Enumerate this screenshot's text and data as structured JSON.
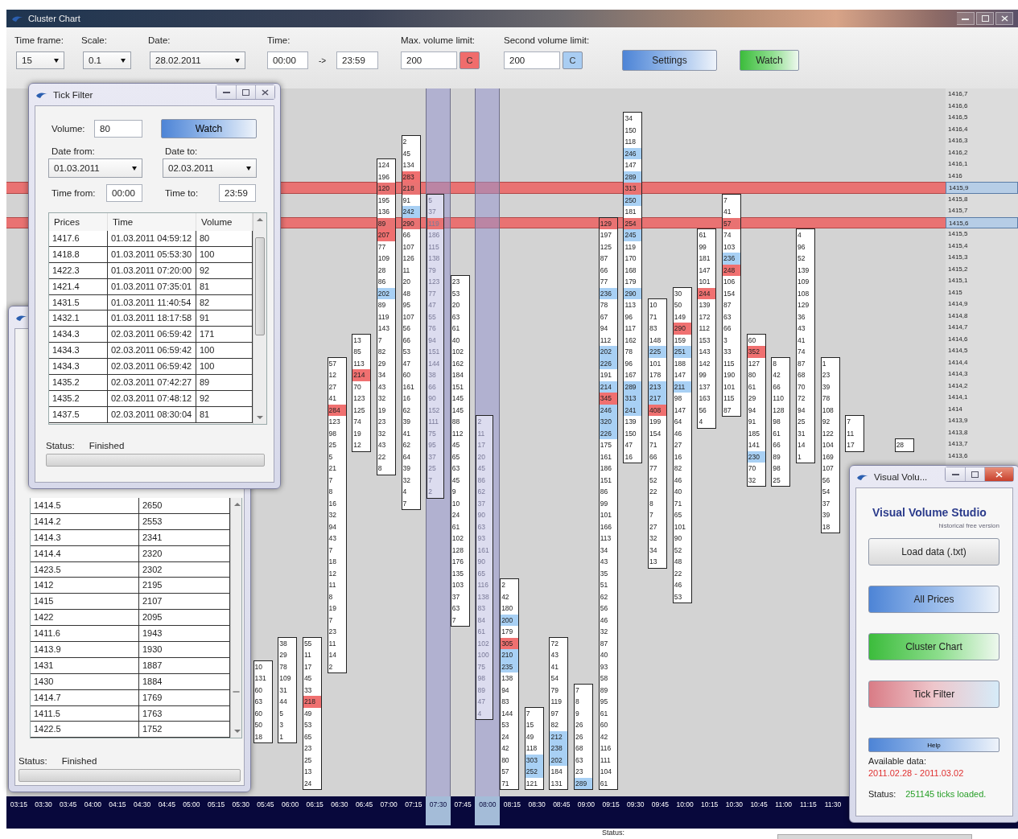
{
  "window": {
    "title": "Cluster Chart"
  },
  "toolbar": {
    "time_frame": {
      "label": "Time frame:",
      "value": "15"
    },
    "scale": {
      "label": "Scale:",
      "value": "0.1"
    },
    "date": {
      "label": "Date:",
      "value": "28.02.2011"
    },
    "time": {
      "label": "Time:",
      "from": "00:00",
      "separator": "->",
      "to": "23:59"
    },
    "max_volume": {
      "label": "Max. volume limit:",
      "value": "200",
      "button": "C",
      "color": "#f06c6c"
    },
    "second_volume": {
      "label": "Second volume limit:",
      "value": "200",
      "button": "C",
      "color": "#a9cdf2"
    },
    "buttons": [
      {
        "label": "Settings",
        "kind": "blue"
      },
      {
        "label": "Watch",
        "kind": "green"
      }
    ]
  },
  "chart": {
    "price_axis": [
      {
        "label": "1416,7",
        "selected": false
      },
      {
        "label": "1416,6",
        "selected": false
      },
      {
        "label": "1416,5",
        "selected": false
      },
      {
        "label": "1416,4",
        "selected": false
      },
      {
        "label": "1416,3",
        "selected": false
      },
      {
        "label": "1416,2",
        "selected": false
      },
      {
        "label": "1416,1",
        "selected": false
      },
      {
        "label": "1416",
        "selected": false
      },
      {
        "label": "1415,9",
        "selected": true
      },
      {
        "label": "1415,8",
        "selected": false
      },
      {
        "label": "1415,7",
        "selected": false
      },
      {
        "label": "1415,6",
        "selected": true
      },
      {
        "label": "1415,5",
        "selected": false
      },
      {
        "label": "1415,4",
        "selected": false
      },
      {
        "label": "1415,3",
        "selected": false
      },
      {
        "label": "1415,2",
        "selected": false
      },
      {
        "label": "1415,1",
        "selected": false
      },
      {
        "label": "1415",
        "selected": false
      },
      {
        "label": "1414,9",
        "selected": false
      },
      {
        "label": "1414,8",
        "selected": false
      },
      {
        "label": "1414,7",
        "selected": false
      },
      {
        "label": "1414,6",
        "selected": false
      },
      {
        "label": "1414,5",
        "selected": false
      },
      {
        "label": "1414,4",
        "selected": false
      },
      {
        "label": "1414,3",
        "selected": false
      },
      {
        "label": "1414,2",
        "selected": false
      },
      {
        "label": "1414,1",
        "selected": false
      },
      {
        "label": "1414",
        "selected": false
      },
      {
        "label": "1413,9",
        "selected": false
      },
      {
        "label": "1413,8",
        "selected": false
      },
      {
        "label": "1413,7",
        "selected": false
      },
      {
        "label": "1413,6",
        "selected": false
      }
    ],
    "slots": [
      {
        "time": "03:15",
        "selected": false
      },
      {
        "time": "03:30",
        "selected": false
      },
      {
        "time": "03:45",
        "selected": false
      },
      {
        "time": "04:00",
        "selected": false
      },
      {
        "time": "04:15",
        "selected": false
      },
      {
        "time": "04:30",
        "selected": false
      },
      {
        "time": "04:45",
        "selected": false
      },
      {
        "time": "05:00",
        "selected": false
      },
      {
        "time": "05:15",
        "selected": false
      },
      {
        "time": "05:30",
        "selected": false
      },
      {
        "time": "05:45",
        "selected": false,
        "cells": [
          null,
          null,
          null,
          null,
          null,
          null,
          null,
          null,
          null,
          null,
          null,
          null,
          null,
          null,
          null,
          null,
          null,
          null,
          null,
          null,
          null,
          null,
          null,
          null,
          null,
          null,
          null,
          null,
          null,
          null,
          null,
          null,
          null,
          null,
          null,
          null,
          null,
          null,
          null,
          null,
          null,
          null,
          null,
          null,
          null,
          null,
          null,
          null,
          null,
          "10",
          "131",
          "60",
          "63",
          "60",
          "50",
          "18"
        ]
      },
      {
        "time": "06:00",
        "selected": false,
        "cells": [
          null,
          null,
          null,
          null,
          null,
          null,
          null,
          null,
          null,
          null,
          null,
          null,
          null,
          null,
          null,
          null,
          null,
          null,
          null,
          null,
          null,
          null,
          null,
          null,
          null,
          null,
          null,
          null,
          null,
          null,
          null,
          null,
          null,
          null,
          null,
          null,
          null,
          null,
          null,
          null,
          null,
          null,
          null,
          null,
          null,
          null,
          null,
          "38",
          "29",
          "78",
          "109",
          "31",
          "44",
          "5",
          "3",
          "1"
        ]
      },
      {
        "time": "06:15",
        "selected": false,
        "cells": [
          null,
          null,
          null,
          null,
          null,
          null,
          null,
          null,
          null,
          null,
          null,
          null,
          null,
          null,
          null,
          null,
          null,
          null,
          null,
          null,
          null,
          null,
          null,
          null,
          null,
          null,
          null,
          null,
          null,
          null,
          null,
          null,
          null,
          null,
          null,
          null,
          null,
          null,
          null,
          null,
          null,
          null,
          null,
          null,
          null,
          null,
          null,
          "55",
          "11",
          "17",
          "45",
          "33",
          {
            "value": "218",
            "color": "#f07070"
          },
          "49",
          "53",
          "65",
          "23",
          "25",
          "13",
          "24"
        ]
      },
      {
        "time": "06:30",
        "selected": false,
        "cells": [
          null,
          null,
          null,
          null,
          null,
          null,
          null,
          null,
          null,
          null,
          null,
          null,
          null,
          null,
          null,
          null,
          null,
          null,
          null,
          null,
          null,
          null,
          null,
          "57",
          "12",
          "27",
          "41",
          {
            "value": "284",
            "color": "#f07070"
          },
          "123",
          "98",
          "25",
          "5",
          "21",
          "7",
          "8",
          "16",
          "32",
          "94",
          "43",
          "7",
          "18",
          "12",
          "11",
          "8",
          "19",
          "7",
          "23",
          "11",
          "14",
          "2"
        ]
      },
      {
        "time": "06:45",
        "selected": false,
        "cells": [
          null,
          null,
          null,
          null,
          null,
          null,
          null,
          null,
          null,
          null,
          null,
          null,
          null,
          null,
          null,
          null,
          null,
          null,
          null,
          null,
          null,
          "13",
          "85",
          "113",
          {
            "value": "214",
            "color": "#f07070"
          },
          "70",
          "123",
          "125",
          "74",
          "19",
          "12"
        ]
      },
      {
        "time": "07:00",
        "selected": false,
        "cells": [
          null,
          null,
          null,
          null,
          null,
          null,
          "124",
          "196",
          "120",
          "195",
          "136",
          "89",
          {
            "value": "207",
            "color": "#f07070"
          },
          "77",
          "109",
          "28",
          "86",
          {
            "value": "202",
            "color": "#a8d0f4"
          },
          "89",
          "119",
          "143",
          "7",
          "82",
          "29",
          "34",
          "43",
          "32",
          "19",
          "23",
          "32",
          "43",
          "22",
          "8"
        ]
      },
      {
        "time": "07:15",
        "selected": false,
        "cells": [
          null,
          null,
          null,
          null,
          "2",
          "45",
          "134",
          {
            "value": "283",
            "color": "#f07070"
          },
          "218",
          "91",
          {
            "value": "242",
            "color": "#a8d0f4"
          },
          "290",
          "66",
          "107",
          "126",
          "11",
          "20",
          "48",
          "95",
          "107",
          "56",
          "66",
          "53",
          "47",
          "60",
          "161",
          "16",
          "62",
          "39",
          "41",
          "62",
          "64",
          "39",
          "32",
          "4",
          "7"
        ]
      },
      {
        "time": "07:30",
        "selected": true,
        "cells": [
          null,
          null,
          null,
          null,
          null,
          null,
          null,
          null,
          null,
          "5",
          "37",
          "119",
          "186",
          "115",
          "138",
          "79",
          "123",
          "77",
          "47",
          "55",
          "76",
          "94",
          "151",
          "144",
          "38",
          "66",
          "90",
          "152",
          "111",
          "75",
          "95",
          "37",
          "25",
          "7",
          "2"
        ]
      },
      {
        "time": "07:45",
        "selected": false,
        "cells": [
          null,
          null,
          null,
          null,
          null,
          null,
          null,
          null,
          null,
          null,
          null,
          null,
          null,
          null,
          null,
          null,
          "23",
          "53",
          "20",
          "63",
          "61",
          "40",
          "102",
          "162",
          "184",
          "151",
          "145",
          "145",
          "88",
          "112",
          "45",
          "65",
          "63",
          "45",
          "9",
          "10",
          "24",
          "61",
          "102",
          "128",
          "176",
          "135",
          "103",
          "37",
          "63",
          "7"
        ]
      },
      {
        "time": "08:00",
        "selected": true,
        "cells": [
          null,
          null,
          null,
          null,
          null,
          null,
          null,
          null,
          null,
          null,
          null,
          null,
          null,
          null,
          null,
          null,
          null,
          null,
          null,
          null,
          null,
          null,
          null,
          null,
          null,
          null,
          null,
          null,
          "2",
          "11",
          "17",
          "20",
          "45",
          "86",
          "62",
          "37",
          "90",
          "63",
          "93",
          "161",
          "90",
          "65",
          "116",
          "138",
          "83",
          "84",
          "61",
          "102",
          "100",
          "75",
          "98",
          "89",
          "47",
          "4"
        ]
      },
      {
        "time": "08:15",
        "selected": false,
        "cells": [
          null,
          null,
          null,
          null,
          null,
          null,
          null,
          null,
          null,
          null,
          null,
          null,
          null,
          null,
          null,
          null,
          null,
          null,
          null,
          null,
          null,
          null,
          null,
          null,
          null,
          null,
          null,
          null,
          null,
          null,
          null,
          null,
          null,
          null,
          null,
          null,
          null,
          null,
          null,
          null,
          null,
          null,
          "2",
          "42",
          "180",
          {
            "value": "200",
            "color": "#a8d0f4"
          },
          "179",
          {
            "value": "305",
            "color": "#f07070"
          },
          {
            "value": "210",
            "color": "#a8d0f4"
          },
          {
            "value": "235",
            "color": "#a8d0f4"
          },
          "138",
          "94",
          "83",
          "144",
          "53",
          "24",
          "42",
          "80",
          "57",
          "71"
        ]
      },
      {
        "time": "08:30",
        "selected": false,
        "cells": [
          null,
          null,
          null,
          null,
          null,
          null,
          null,
          null,
          null,
          null,
          null,
          null,
          null,
          null,
          null,
          null,
          null,
          null,
          null,
          null,
          null,
          null,
          null,
          null,
          null,
          null,
          null,
          null,
          null,
          null,
          null,
          null,
          null,
          null,
          null,
          null,
          null,
          null,
          null,
          null,
          null,
          null,
          null,
          null,
          null,
          null,
          null,
          null,
          null,
          null,
          null,
          null,
          null,
          "7",
          "15",
          "49",
          "118",
          {
            "value": "303",
            "color": "#a8d0f4"
          },
          {
            "value": "252",
            "color": "#a8d0f4"
          },
          "121"
        ]
      },
      {
        "time": "08:45",
        "selected": false,
        "cells": [
          null,
          null,
          null,
          null,
          null,
          null,
          null,
          null,
          null,
          null,
          null,
          null,
          null,
          null,
          null,
          null,
          null,
          null,
          null,
          null,
          null,
          null,
          null,
          null,
          null,
          null,
          null,
          null,
          null,
          null,
          null,
          null,
          null,
          null,
          null,
          null,
          null,
          null,
          null,
          null,
          null,
          null,
          null,
          null,
          null,
          null,
          null,
          "72",
          "43",
          "41",
          "54",
          "79",
          "119",
          "97",
          "82",
          {
            "value": "212",
            "color": "#a8d0f4"
          },
          {
            "value": "238",
            "color": "#a8d0f4"
          },
          {
            "value": "202",
            "color": "#a8d0f4"
          },
          "184",
          "131"
        ]
      },
      {
        "time": "09:00",
        "selected": false,
        "cells": [
          null,
          null,
          null,
          null,
          null,
          null,
          null,
          null,
          null,
          null,
          null,
          null,
          null,
          null,
          null,
          null,
          null,
          null,
          null,
          null,
          null,
          null,
          null,
          null,
          null,
          null,
          null,
          null,
          null,
          null,
          null,
          null,
          null,
          null,
          null,
          null,
          null,
          null,
          null,
          null,
          null,
          null,
          null,
          null,
          null,
          null,
          null,
          null,
          null,
          null,
          null,
          "7",
          "8",
          "9",
          "26",
          "26",
          "68",
          "63",
          "23",
          {
            "value": "289",
            "color": "#a8d0f4"
          }
        ]
      },
      {
        "time": "09:15",
        "selected": false,
        "cells": [
          null,
          null,
          null,
          null,
          null,
          null,
          null,
          null,
          null,
          null,
          null,
          "129",
          "197",
          "125",
          "87",
          "66",
          "77",
          {
            "value": "236",
            "color": "#a8d0f4"
          },
          "78",
          "67",
          "94",
          "112",
          {
            "value": "202",
            "color": "#a8d0f4"
          },
          {
            "value": "226",
            "color": "#a8d0f4"
          },
          "191",
          {
            "value": "214",
            "color": "#a8d0f4"
          },
          {
            "value": "345",
            "color": "#f07070"
          },
          {
            "value": "246",
            "color": "#a8d0f4"
          },
          {
            "value": "320",
            "color": "#a8d0f4"
          },
          {
            "value": "226",
            "color": "#a8d0f4"
          },
          "175",
          "161",
          "186",
          "151",
          "86",
          "99",
          "101",
          "166",
          "113",
          "34",
          "43",
          "35",
          "51",
          "62",
          "56",
          "46",
          "32",
          "87",
          "40",
          "93",
          "58",
          "89",
          "95",
          "61",
          "60",
          "42",
          "116",
          "111",
          "104",
          "61"
        ]
      },
      {
        "time": "09:30",
        "selected": false,
        "cells": [
          null,
          null,
          "34",
          "150",
          "118",
          {
            "value": "246",
            "color": "#a8d0f4"
          },
          "147",
          {
            "value": "289",
            "color": "#a8d0f4"
          },
          "313",
          {
            "value": "250",
            "color": "#a8d0f4"
          },
          "181",
          "254",
          {
            "value": "245",
            "color": "#a8d0f4"
          },
          "119",
          "170",
          "168",
          "179",
          {
            "value": "290",
            "color": "#a8d0f4"
          },
          "113",
          "96",
          "117",
          "162",
          "78",
          "96",
          "167",
          {
            "value": "289",
            "color": "#a8d0f4"
          },
          {
            "value": "313",
            "color": "#a8d0f4"
          },
          {
            "value": "241",
            "color": "#a8d0f4"
          },
          "139",
          "150",
          "47",
          "16"
        ]
      },
      {
        "time": "09:45",
        "selected": false,
        "cells": [
          null,
          null,
          null,
          null,
          null,
          null,
          null,
          null,
          null,
          null,
          null,
          null,
          null,
          null,
          null,
          null,
          null,
          null,
          "10",
          "71",
          "83",
          "148",
          {
            "value": "225",
            "color": "#a8d0f4"
          },
          "101",
          "178",
          {
            "value": "213",
            "color": "#a8d0f4"
          },
          {
            "value": "217",
            "color": "#a8d0f4"
          },
          {
            "value": "408",
            "color": "#f07070"
          },
          "199",
          "154",
          "71",
          "66",
          "77",
          "52",
          "22",
          "8",
          "7",
          "27",
          "32",
          "34",
          "13"
        ]
      },
      {
        "time": "10:00",
        "selected": false,
        "cells": [
          null,
          null,
          null,
          null,
          null,
          null,
          null,
          null,
          null,
          null,
          null,
          null,
          null,
          null,
          null,
          null,
          null,
          "30",
          "50",
          "149",
          {
            "value": "290",
            "color": "#f07070"
          },
          "159",
          {
            "value": "251",
            "color": "#a8d0f4"
          },
          "188",
          "147",
          {
            "value": "211",
            "color": "#a8d0f4"
          },
          "98",
          "147",
          "64",
          "46",
          "27",
          "16",
          "82",
          "46",
          "40",
          "71",
          "65",
          "101",
          "90",
          "52",
          "48",
          "22",
          "46",
          "53"
        ]
      },
      {
        "time": "10:15",
        "selected": false,
        "cells": [
          null,
          null,
          null,
          null,
          null,
          null,
          null,
          null,
          null,
          null,
          null,
          null,
          "61",
          "99",
          "181",
          "147",
          "101",
          {
            "value": "244",
            "color": "#f07070"
          },
          "139",
          "172",
          "112",
          "153",
          "143",
          "142",
          "99",
          "137",
          "163",
          "56",
          "4"
        ]
      },
      {
        "time": "10:30",
        "selected": false,
        "cells": [
          null,
          null,
          null,
          null,
          null,
          null,
          null,
          null,
          null,
          "7",
          "41",
          "57",
          "74",
          "103",
          {
            "value": "236",
            "color": "#a8d0f4"
          },
          {
            "value": "248",
            "color": "#f07070"
          },
          "106",
          "154",
          "87",
          "63",
          "66",
          "3",
          "33",
          "115",
          "190",
          "101",
          "115",
          "87"
        ]
      },
      {
        "time": "10:45",
        "selected": false,
        "cells": [
          null,
          null,
          null,
          null,
          null,
          null,
          null,
          null,
          null,
          null,
          null,
          null,
          null,
          null,
          null,
          null,
          null,
          null,
          null,
          null,
          null,
          "60",
          {
            "value": "352",
            "color": "#f07070"
          },
          "127",
          "80",
          "61",
          "29",
          "94",
          "91",
          "185",
          "141",
          {
            "value": "230",
            "color": "#a8d0f4"
          },
          "70",
          "32"
        ]
      },
      {
        "time": "11:00",
        "selected": false,
        "cells": [
          null,
          null,
          null,
          null,
          null,
          null,
          null,
          null,
          null,
          null,
          null,
          null,
          null,
          null,
          null,
          null,
          null,
          null,
          null,
          null,
          null,
          null,
          null,
          "8",
          "42",
          "66",
          "110",
          "128",
          "98",
          "61",
          "66",
          "89",
          "98",
          "25"
        ]
      },
      {
        "time": "11:15",
        "selected": false,
        "cells": [
          null,
          null,
          null,
          null,
          null,
          null,
          null,
          null,
          null,
          null,
          null,
          null,
          "4",
          "96",
          "52",
          "139",
          "109",
          "108",
          "129",
          "36",
          "43",
          "41",
          "74",
          "87",
          "68",
          "70",
          "72",
          "94",
          "25",
          "31",
          "14",
          "1"
        ]
      },
      {
        "time": "11:30",
        "selected": false,
        "cells": [
          null,
          null,
          null,
          null,
          null,
          null,
          null,
          null,
          null,
          null,
          null,
          null,
          null,
          null,
          null,
          null,
          null,
          null,
          null,
          null,
          null,
          null,
          null,
          "1",
          "23",
          "39",
          "78",
          "108",
          "92",
          "122",
          "104",
          "169",
          "107",
          "56",
          "54",
          "37",
          "39",
          "18"
        ]
      },
      {
        "selected": false,
        "cells": [
          null,
          null,
          null,
          null,
          null,
          null,
          null,
          null,
          null,
          null,
          null,
          null,
          null,
          null,
          null,
          null,
          null,
          null,
          null,
          null,
          null,
          null,
          null,
          null,
          null,
          null,
          null,
          null,
          "7",
          "11",
          "17"
        ]
      },
      {
        "selected": false
      },
      {
        "selected": false,
        "cells": [
          null,
          null,
          null,
          null,
          null,
          null,
          null,
          null,
          null,
          null,
          null,
          null,
          null,
          null,
          null,
          null,
          null,
          null,
          null,
          null,
          null,
          null,
          null,
          null,
          null,
          null,
          null,
          null,
          null,
          null,
          "28"
        ]
      }
    ]
  },
  "status_bar": {
    "label": "Status:",
    "progress": {
      "level": 0
    }
  },
  "tick_filter": {
    "title": "Tick Filter",
    "volume": {
      "label": "Volume:",
      "value": "80"
    },
    "watch_button": "Watch",
    "date_from": {
      "label": "Date from:",
      "value": "01.03.2011"
    },
    "date_to": {
      "label": "Date to:",
      "value": "02.03.2011"
    },
    "time_from": {
      "label": "Time from:",
      "value": "00:00"
    },
    "time_to": {
      "label": "Time to:",
      "value": "23:59"
    },
    "table": {
      "columns": [
        "Prices",
        "Time",
        "Volume"
      ],
      "rows": [
        [
          "1417.6",
          "01.03.2011 04:59:12",
          "80"
        ],
        [
          "1418.8",
          "01.03.2011 05:53:30",
          "100"
        ],
        [
          "1422.3",
          "01.03.2011 07:20:00",
          "92"
        ],
        [
          "1421.4",
          "01.03.2011 07:35:01",
          "81"
        ],
        [
          "1431.5",
          "01.03.2011 11:40:54",
          "82"
        ],
        [
          "1432.1",
          "01.03.2011 18:17:58",
          "91"
        ],
        [
          "1434.3",
          "02.03.2011 06:59:42",
          "171"
        ],
        [
          "1434.3",
          "02.03.2011 06:59:42",
          "100"
        ],
        [
          "1434.3",
          "02.03.2011 06:59:42",
          "100"
        ],
        [
          "1435.2",
          "02.03.2011 07:42:27",
          "89"
        ],
        [
          "1435.2",
          "02.03.2011 07:48:12",
          "92"
        ],
        [
          "1437.5",
          "02.03.2011 08:30:04",
          "81"
        ]
      ]
    },
    "status": {
      "label": "Status:",
      "value": "Finished"
    },
    "progress": {
      "level": 0
    }
  },
  "all_prices": {
    "table": {
      "rows": [
        [
          "1414.5",
          "2650"
        ],
        [
          "1414.2",
          "2553"
        ],
        [
          "1414.3",
          "2341"
        ],
        [
          "1414.4",
          "2320"
        ],
        [
          "1423.5",
          "2302"
        ],
        [
          "1412",
          "2195"
        ],
        [
          "1415",
          "2107"
        ],
        [
          "1422",
          "2095"
        ],
        [
          "1411.6",
          "1943"
        ],
        [
          "1413.9",
          "1930"
        ],
        [
          "1431",
          "1887"
        ],
        [
          "1430",
          "1884"
        ],
        [
          "1414.7",
          "1769"
        ],
        [
          "1411.5",
          "1763"
        ],
        [
          "1422.5",
          "1752"
        ]
      ]
    },
    "status": {
      "label": "Status:",
      "value": "Finished"
    },
    "progress": {
      "level": 0
    }
  },
  "studio": {
    "title": "Visual Volu...",
    "heading": "Visual Volume Studio",
    "subheading": "historical free version",
    "buttons": [
      {
        "label": "Load data (.txt)",
        "kind": "gray"
      },
      {
        "label": "All Prices",
        "kind": "blue"
      },
      {
        "label": "Cluster Chart",
        "kind": "green"
      },
      {
        "label": "Tick Filter",
        "kind": "red"
      }
    ],
    "help": "Help",
    "available": {
      "label": "Available data:",
      "value": "2011.02.28 - 2011.03.02"
    },
    "status": {
      "label": "Status:",
      "value": "251145 ticks loaded."
    }
  }
}
